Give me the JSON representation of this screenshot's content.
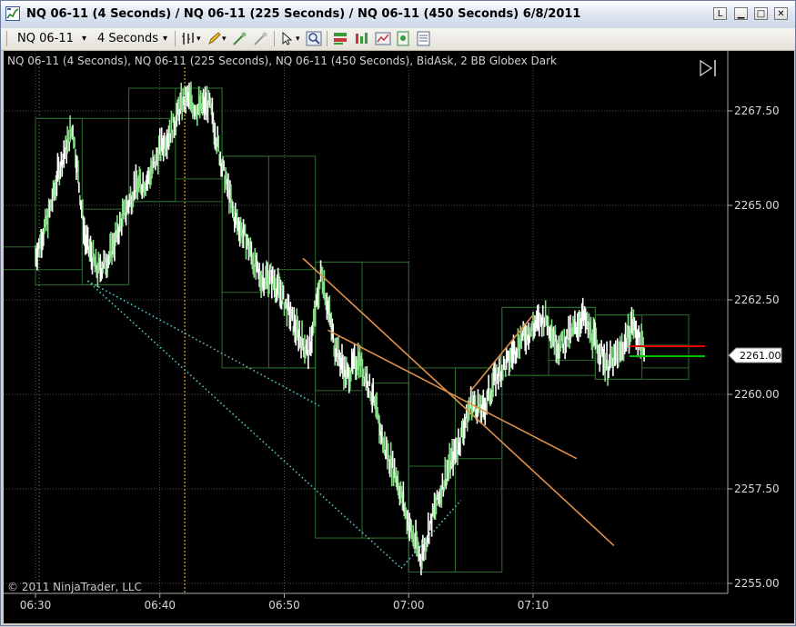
{
  "window": {
    "title": "NQ 06-11 (4 Seconds) / NQ 06-11 (225 Seconds) / NQ 06-11 (450 Seconds)  6/8/2011",
    "btn_l": "L",
    "btn_min": "▁",
    "btn_max": "□",
    "btn_close": "✕"
  },
  "toolbar": {
    "instrument": "NQ 06-11",
    "interval": "4 Seconds",
    "dropdown_icon": "▾"
  },
  "chart": {
    "header": "NQ 06-11 (4 Seconds), NQ 06-11 (225 Seconds), NQ 06-11 (450 Seconds), BidAsk, 2 BB Globex Dark",
    "copyright": "© 2011 NinjaTrader, LLC",
    "current_price_label": "2261.00",
    "colors": {
      "background": "#000000",
      "price_up": "#ffffff",
      "price_down": "#88dd88",
      "box_border": "#2e6b2e",
      "trendline": "#e0904a",
      "dotted_line": "#5fc8c8",
      "vertical_marker": "#d49a1e",
      "ask_line": "#e00000",
      "bid_line": "#00c000"
    }
  },
  "chart_data": {
    "type": "line",
    "x_ticks": [
      "06:30",
      "06:40",
      "06:50",
      "07:00",
      "07:10"
    ],
    "y_ticks": [
      "2267.50",
      "2265.00",
      "2262.50",
      "2260.00",
      "2257.50",
      "2255.00"
    ],
    "ylim": [
      2254.8,
      2268.3
    ],
    "grid": true,
    "series": [
      {
        "values": [
          [
            "06:30",
            2263.6
          ],
          [
            "06:31",
            2264.6
          ],
          [
            "06:32",
            2266.0
          ],
          [
            "06:33",
            2267.0
          ],
          [
            "06:34",
            2264.0
          ],
          [
            "06:35",
            2263.2
          ],
          [
            "06:36",
            2263.6
          ],
          [
            "06:37",
            2264.6
          ],
          [
            "06:38",
            2265.4
          ],
          [
            "06:39",
            2265.6
          ],
          [
            "06:40",
            2266.4
          ],
          [
            "06:41",
            2267.0
          ],
          [
            "06:42",
            2267.8
          ],
          [
            "06:43",
            2267.5
          ],
          [
            "06:44",
            2267.6
          ],
          [
            "06:45",
            2266.0
          ],
          [
            "06:46",
            2264.6
          ],
          [
            "06:47",
            2264.0
          ],
          [
            "06:48",
            2263.0
          ],
          [
            "06:49",
            2263.0
          ],
          [
            "06:50",
            2262.4
          ],
          [
            "06:51",
            2261.6
          ],
          [
            "06:52",
            2261.0
          ],
          [
            "06:53",
            2263.2
          ],
          [
            "06:54",
            2261.3
          ],
          [
            "06:55",
            2260.4
          ],
          [
            "06:56",
            2260.9
          ],
          [
            "06:57",
            2260.0
          ],
          [
            "06:58",
            2258.6
          ],
          [
            "06:59",
            2257.8
          ],
          [
            "07:00",
            2256.5
          ],
          [
            "07:01",
            2255.6
          ],
          [
            "07:02",
            2256.8
          ],
          [
            "07:03",
            2257.8
          ],
          [
            "07:04",
            2258.6
          ],
          [
            "07:05",
            2259.7
          ],
          [
            "07:06",
            2259.5
          ],
          [
            "07:07",
            2260.4
          ],
          [
            "07:08",
            2260.8
          ],
          [
            "07:09",
            2261.4
          ],
          [
            "07:10",
            2261.7
          ],
          [
            "07:11",
            2262.0
          ],
          [
            "07:12",
            2261.2
          ],
          [
            "07:13",
            2261.5
          ],
          [
            "07:14",
            2262.0
          ],
          [
            "07:15",
            2261.3
          ],
          [
            "07:16",
            2260.7
          ],
          [
            "07:17",
            2261.0
          ],
          [
            "07:18",
            2261.8
          ],
          [
            "07:19",
            2261.0
          ]
        ]
      }
    ]
  }
}
